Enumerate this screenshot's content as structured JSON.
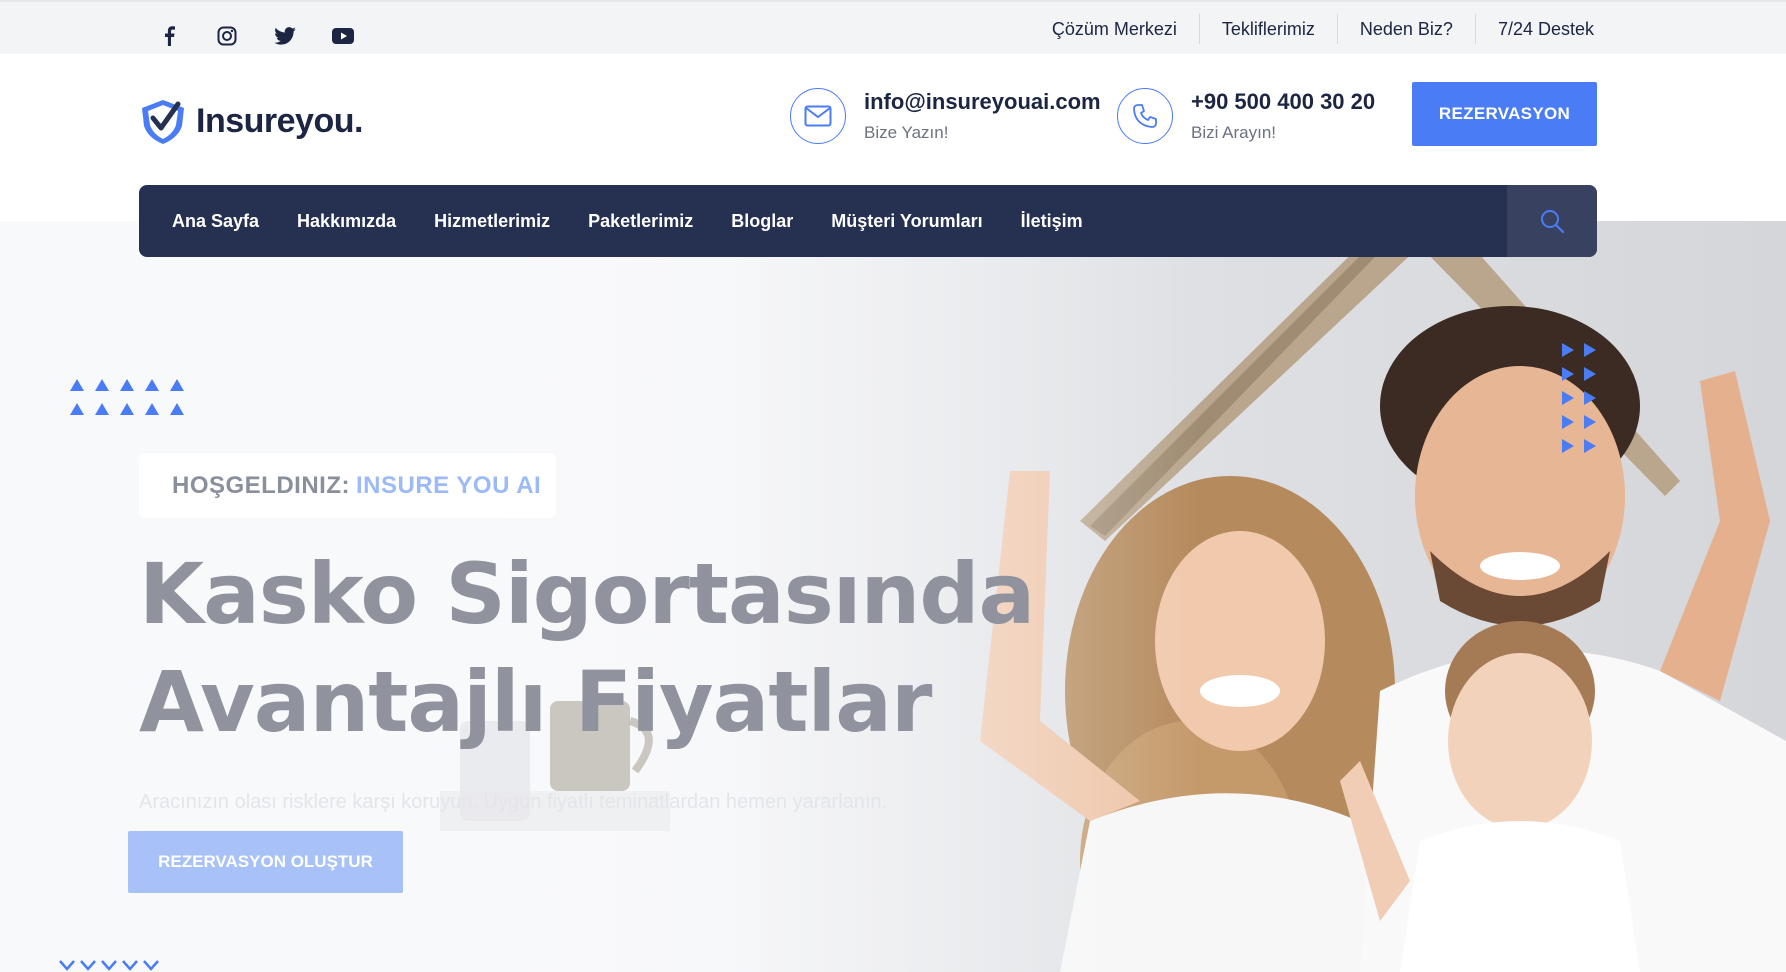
{
  "topbar": {
    "social": [
      "facebook-icon",
      "instagram-icon",
      "twitter-icon",
      "youtube-icon"
    ],
    "links": [
      "Çözüm Merkezi",
      "Tekliflerimiz",
      "Neden Biz?",
      "7/24 Destek"
    ]
  },
  "header": {
    "logo_text": "Insureyou.",
    "email": {
      "value": "info@insureyouai.com",
      "label": "Bize Yazın!"
    },
    "phone": {
      "value": "+90 500 400 30 20",
      "label": "Bizi Arayın!"
    },
    "cta": "REZERVASYON"
  },
  "nav": {
    "items": [
      "Ana Sayfa",
      "Hakkımızda",
      "Hizmetlerimiz",
      "Paketlerimiz",
      "Bloglar",
      "Müşteri Yorumları",
      "İletişim"
    ]
  },
  "hero": {
    "welcome_prefix": "HOŞGELDINIZ:",
    "welcome_brand": "INSURE YOU AI",
    "headline_line1": "Kasko Sigortasında",
    "headline_line2": "Avantajlı Fiyatlar",
    "subtext": "Aracınızın olası risklere karşı koruyun. Uygun fiyatlı teminatlardan hemen yararlanın.",
    "cta": "REZERVASYON OLUŞTUR"
  },
  "colors": {
    "accent": "#4a7cf5",
    "nav_bg": "#263050",
    "text_dark": "#1c2541"
  }
}
